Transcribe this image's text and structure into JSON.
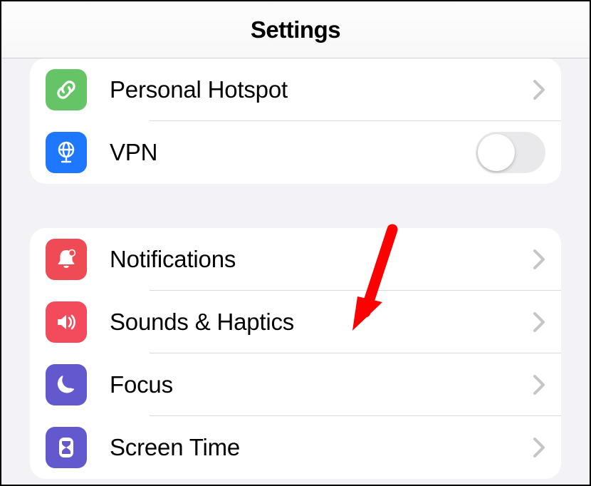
{
  "header": {
    "title": "Settings"
  },
  "group1": {
    "items": [
      {
        "label": "Personal Hotspot",
        "icon": "link-icon",
        "color": "bg-green",
        "accessory": "chevron"
      },
      {
        "label": "VPN",
        "icon": "globe-icon",
        "color": "bg-blue",
        "accessory": "toggle",
        "toggle_on": false
      }
    ]
  },
  "group2": {
    "items": [
      {
        "label": "Notifications",
        "icon": "bell-icon",
        "color": "bg-red",
        "accessory": "chevron"
      },
      {
        "label": "Sounds & Haptics",
        "icon": "speaker-icon",
        "color": "bg-pink",
        "accessory": "chevron"
      },
      {
        "label": "Focus",
        "icon": "moon-icon",
        "color": "bg-indigo",
        "accessory": "chevron"
      },
      {
        "label": "Screen Time",
        "icon": "hourglass-icon",
        "color": "bg-indigo",
        "accessory": "chevron"
      }
    ]
  },
  "annotation": {
    "type": "arrow",
    "target": "Sounds & Haptics",
    "color": "#ff0000"
  }
}
